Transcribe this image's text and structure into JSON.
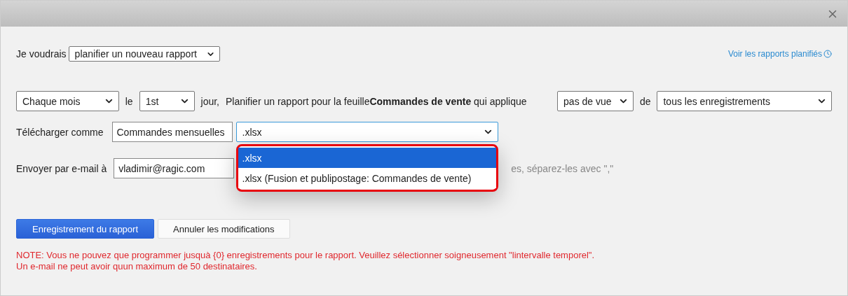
{
  "intro": {
    "label": "Je voudrais",
    "select": "planifier un nouveau rapport"
  },
  "scheduled_link": "Voir les rapports planifiés",
  "schedule": {
    "frequency": "Chaque mois",
    "day_prefix": "le",
    "day": "1st",
    "day_suffix": "jour,",
    "sentence": "Planifier un rapport pour la feuille**Commandes de vente** qui applique",
    "view": "pas de vue",
    "view_suffix": "de",
    "records": "tous les enregistrements"
  },
  "download": {
    "label": "Télécharger comme",
    "filename": "Commandes mensuelles",
    "format": ".xlsx",
    "format_options": [
      {
        "label": ".xlsx",
        "selected": true
      },
      {
        "label": ".xlsx (Fusion et publipostage: Commandes de vente)",
        "selected": false
      }
    ]
  },
  "email": {
    "label": "Envoyer par e-mail à",
    "value": "vladimir@ragic.com",
    "hint": "es, séparez-les avec \",\""
  },
  "buttons": [
    {
      "label": "Enregistrement du rapport",
      "kind": "primary"
    },
    {
      "label": "Annuler les modifications",
      "kind": "secondary"
    }
  ],
  "notes": [
    "NOTE: Vous ne pouvez que programmer jusquà {0} enregistrements pour le rapport. Veuillez sélectionner soigneusement \"lintervalle temporel\".",
    "Un e-mail ne peut avoir quun maximum de 50 destinataires."
  ]
}
